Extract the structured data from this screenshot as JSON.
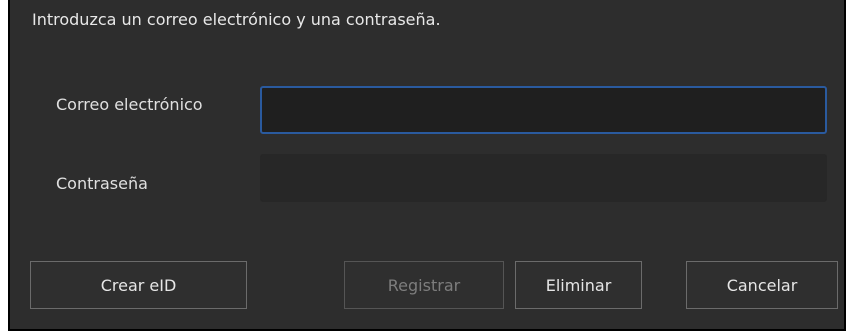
{
  "dialog": {
    "instruction": "Introduzca un correo electrónico y una contraseña.",
    "fields": {
      "email_label": "Correo electrónico",
      "email_value": "",
      "password_label": "Contraseña",
      "password_value": ""
    },
    "buttons": {
      "create_eid": "Crear eID",
      "register": "Registrar",
      "delete": "Eliminar",
      "cancel": "Cancelar"
    },
    "colors": {
      "background": "#2d2d2d",
      "input_focus_border": "#2a5a9e",
      "disabled_text": "#7d7d7d"
    }
  }
}
